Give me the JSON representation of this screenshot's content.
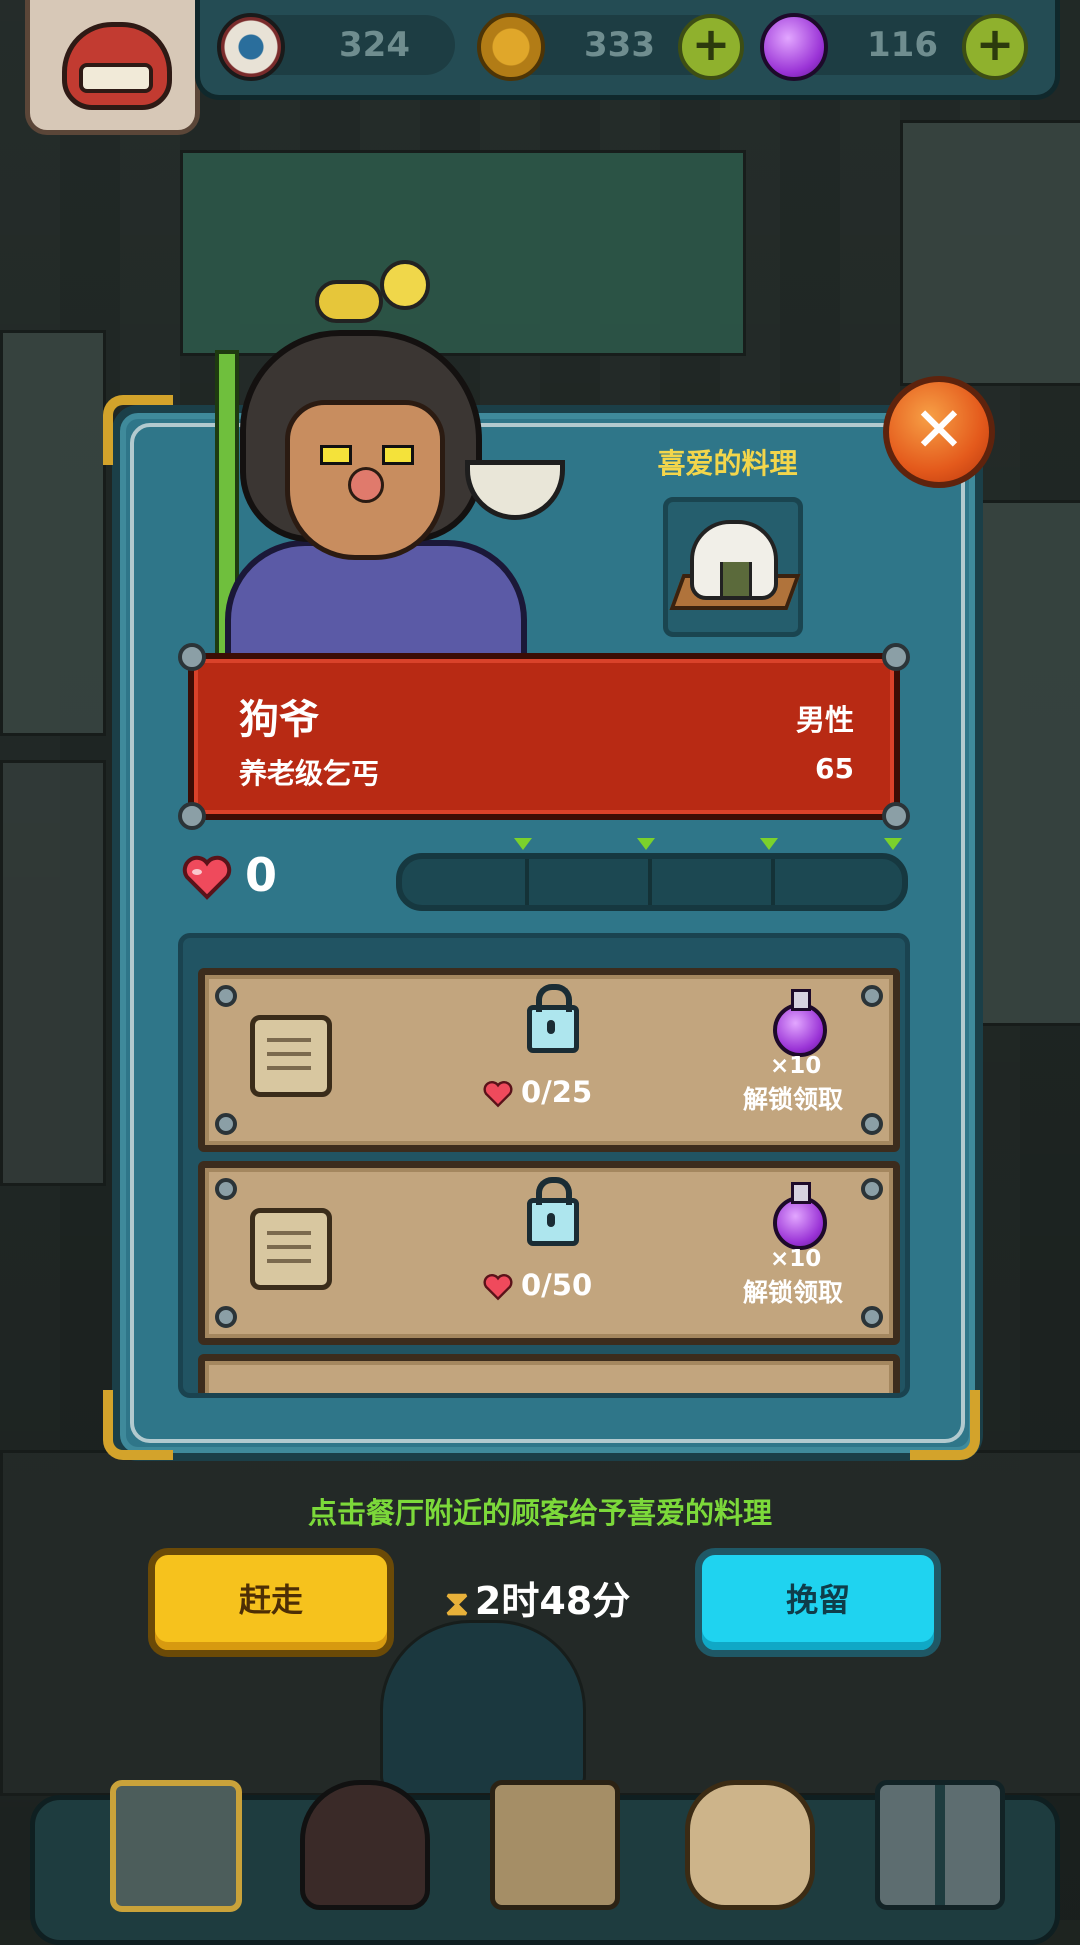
{
  "hud": {
    "eyes": "324",
    "coins": "333",
    "potions": "116",
    "add_coins_label": "+",
    "add_potions_label": "+"
  },
  "panel": {
    "close_label": "✕",
    "favorite_dish_title": "喜爱的料理",
    "character": {
      "name": "狗爷",
      "gender": "男性",
      "title": "养老级乞丐",
      "level": "65"
    },
    "favor": {
      "value": "0"
    },
    "rewards": [
      {
        "requirement": "0/25",
        "quantity": "×10",
        "action": "解锁领取"
      },
      {
        "requirement": "0/50",
        "quantity": "×10",
        "action": "解锁领取"
      }
    ]
  },
  "hint": "点击餐厅附近的顾客给予喜爱的料理",
  "actions": {
    "dismiss_label": "赶走",
    "retain_label": "挽留",
    "timer": "2时48分"
  },
  "colors": {
    "panel": "#2f7689",
    "banner": "#b82a14",
    "dismiss_button": "#f6c21d",
    "retain_button": "#1fd3f0",
    "hint_text": "#7cd93a",
    "favorite_title": "#f3d64b"
  },
  "icons": {
    "hud": [
      "eyeball-icon",
      "coin-icon",
      "potion-icon"
    ],
    "panel": [
      "close-icon",
      "onigiri-dish-icon",
      "heart-icon",
      "scroll-icon",
      "lock-icon",
      "potion-icon",
      "hourglass-icon"
    ],
    "nav": [
      "restaurant-icon",
      "monster-icon",
      "recipe-book-icon",
      "money-bag-icon",
      "grid-menu-icon"
    ]
  }
}
